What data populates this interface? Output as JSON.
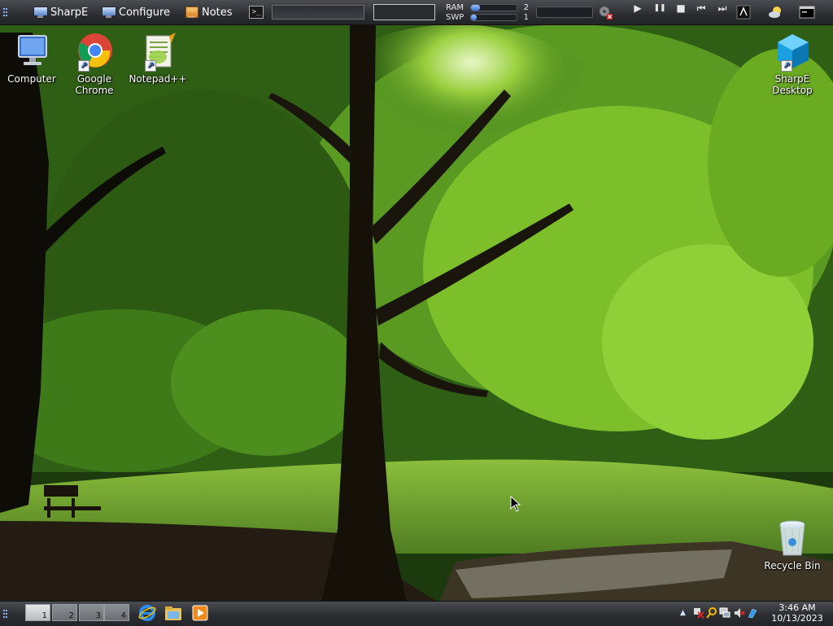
{
  "top_panel": {
    "launchers": [
      {
        "label": "SharpE",
        "icon": "monitor-icon"
      },
      {
        "label": "Configure",
        "icon": "monitor-icon"
      },
      {
        "label": "Notes",
        "icon": "notes-icon"
      }
    ],
    "terminal_button": {
      "icon": "terminal-icon",
      "glyph": ">_"
    },
    "run_input": {
      "value": "",
      "placeholder": ""
    },
    "memory": [
      {
        "label": "RAM",
        "value": "2",
        "fill_fraction": 0.2
      },
      {
        "label": "SWP",
        "value": "1",
        "fill_fraction": 0.12
      }
    ],
    "volume_level": 0.0,
    "media_controls": [
      "play",
      "pause",
      "stop",
      "previous",
      "next"
    ],
    "media_glyphs": {
      "play": "▶",
      "pause": "❚❚",
      "stop": "■",
      "previous": "⏮",
      "next": "⏭"
    }
  },
  "desktop": {
    "icons": [
      {
        "label": "Computer",
        "icon": "computer-icon"
      },
      {
        "label": "Google Chrome",
        "icon": "chrome-icon"
      },
      {
        "label": "Notepad++",
        "icon": "notepad-plus-plus-icon"
      },
      {
        "label": "SharpE Desktop",
        "icon": "sharpe-desktop-icon"
      },
      {
        "label": "Recycle Bin",
        "icon": "recycle-bin-icon"
      }
    ]
  },
  "taskbar": {
    "workspaces": [
      "1",
      "2",
      "3",
      "4"
    ],
    "active_workspace": "1",
    "quick_launch": [
      "internet-explorer-icon",
      "file-explorer-icon",
      "media-player-icon"
    ],
    "tray_icons": [
      "arrow-up-icon",
      "flag-icon",
      "search-icon",
      "network-icon",
      "volume-muted-icon",
      "bluetooth-icon"
    ]
  },
  "clock": {
    "time": "3:46 AM",
    "date": "10/13/2023"
  },
  "colors": {
    "panel": "#2b2d31",
    "accent_blue": "#3a6fd0",
    "wallpaper_green": "#3f7a1c"
  }
}
